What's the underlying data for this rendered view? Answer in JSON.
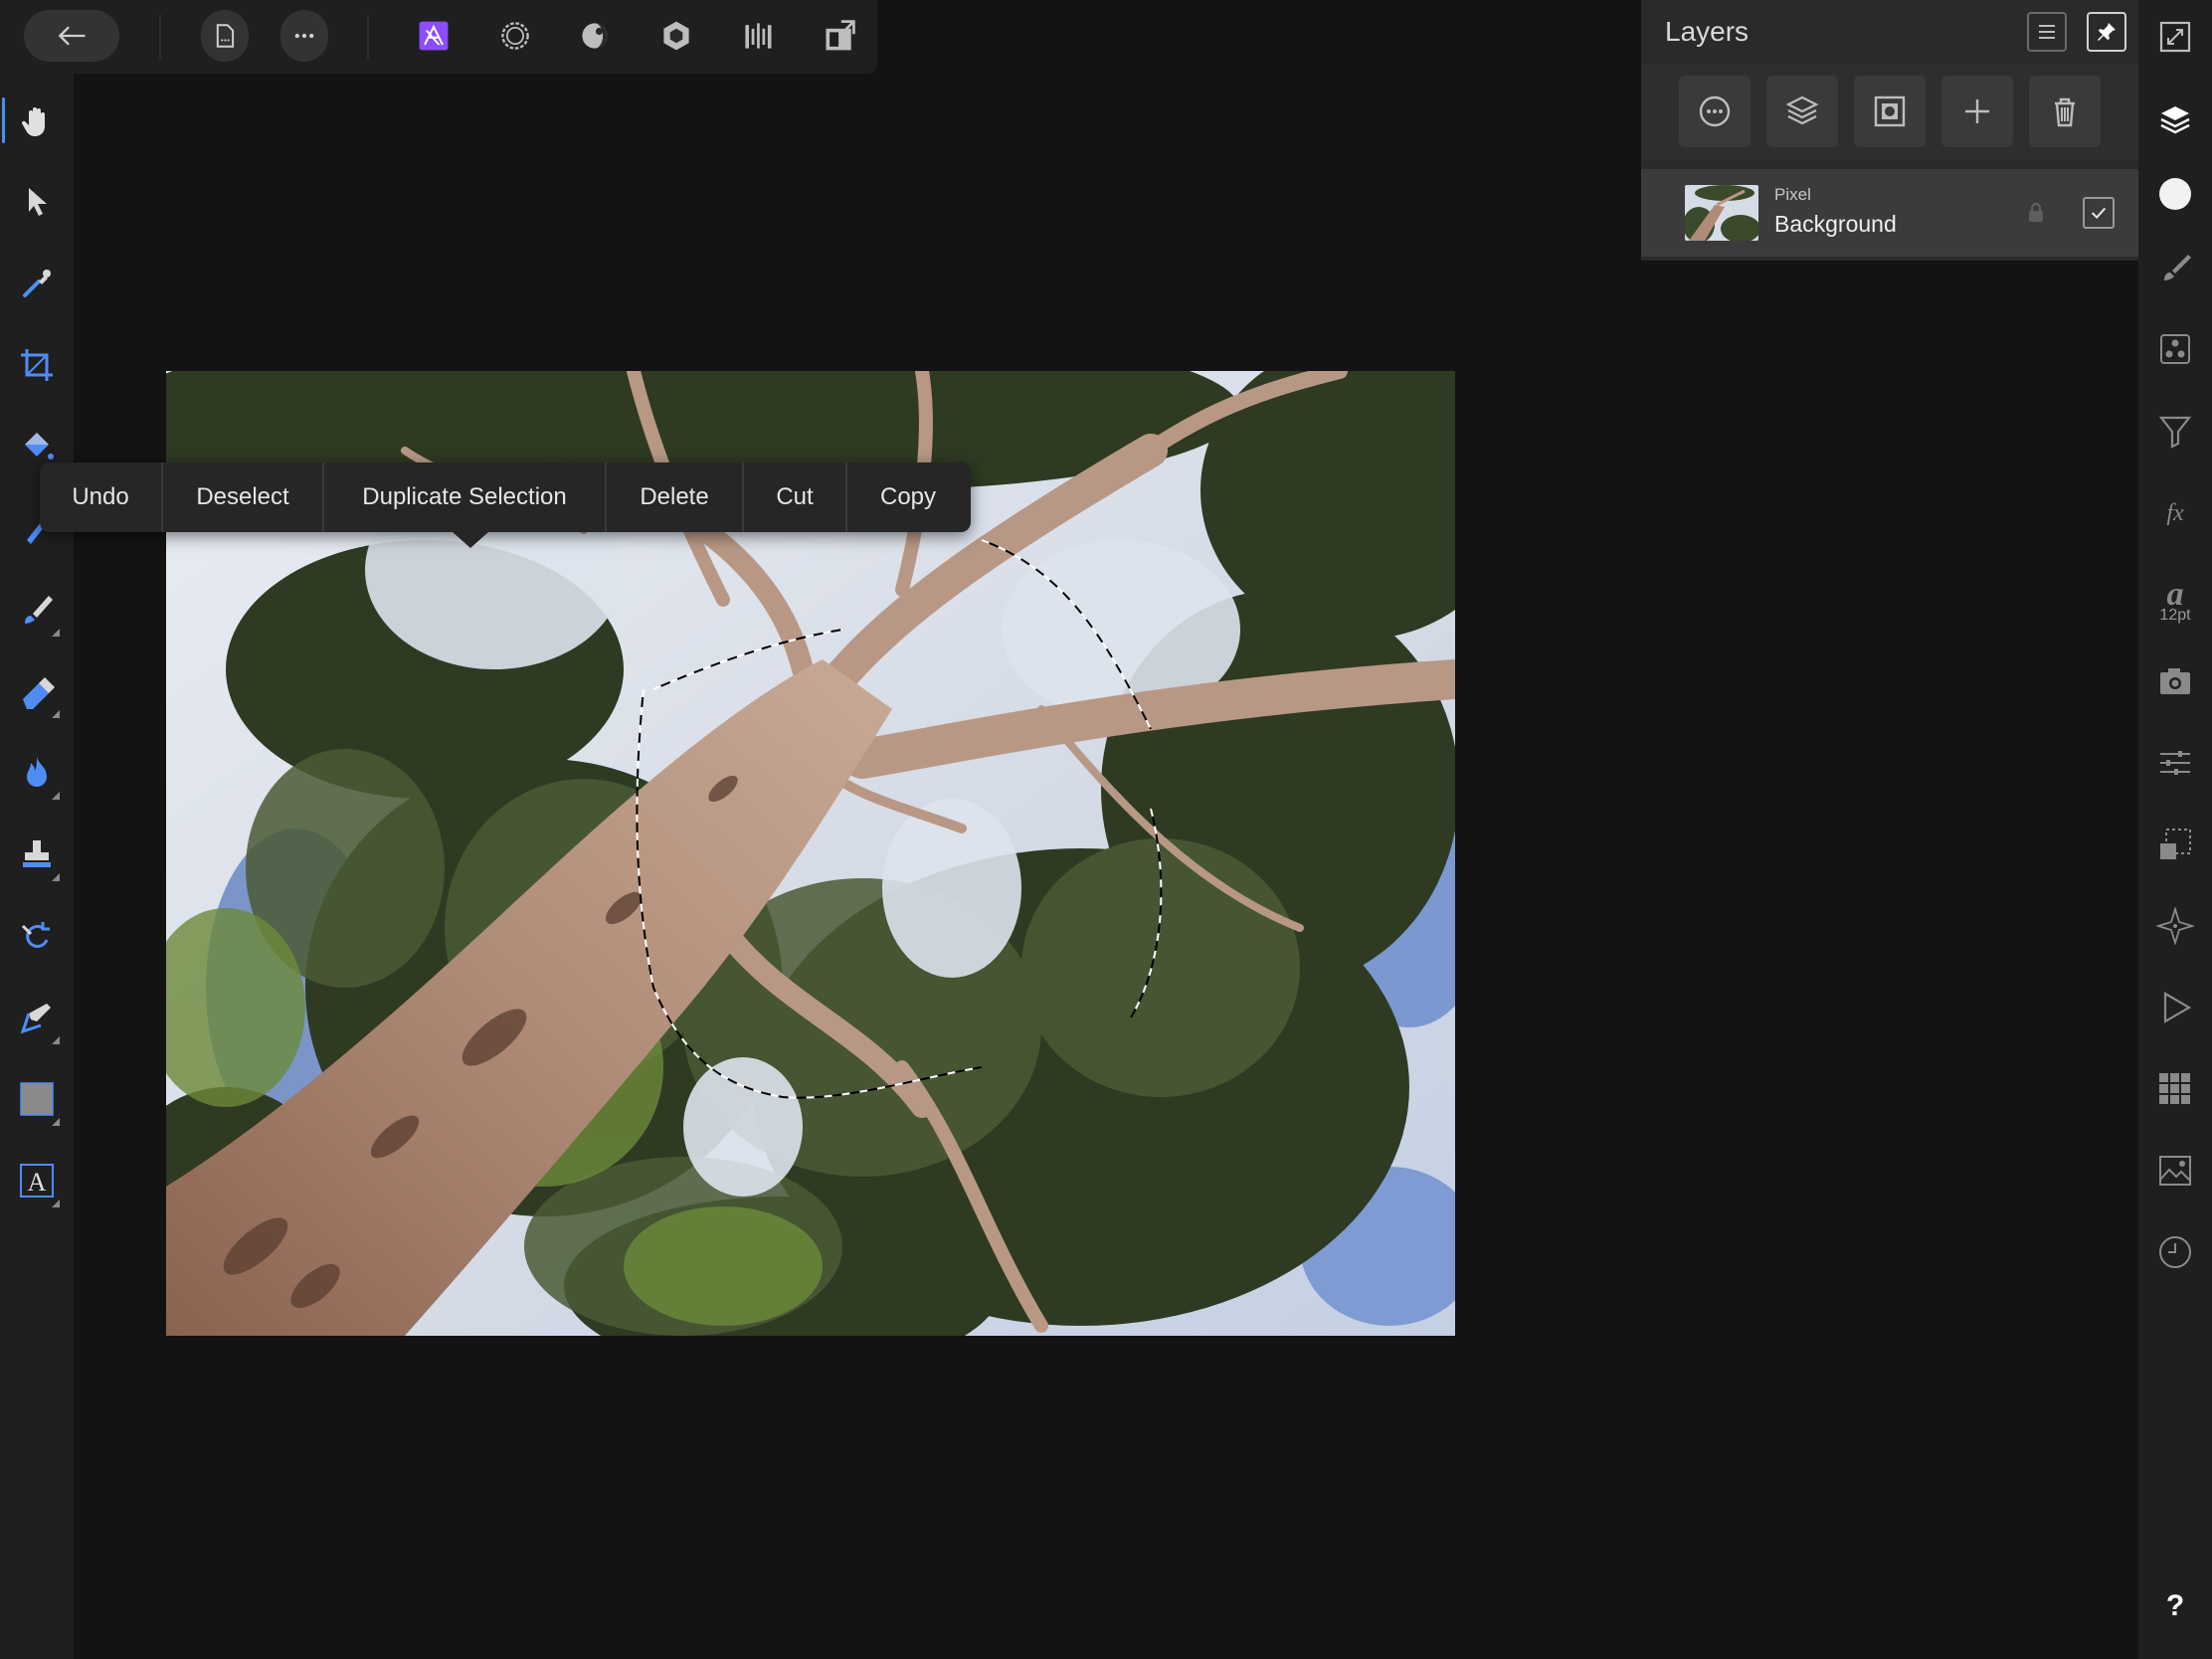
{
  "top_bar": {
    "back_icon": "back-arrow-icon",
    "document_icon": "document-icon",
    "more_icon": "more-icon",
    "personas": [
      "photo-persona-icon",
      "liquify-persona-icon",
      "develop-persona-icon",
      "tone-mapping-persona-icon",
      "export-persona-icon"
    ],
    "view_mode_icon": "view-mode-icon"
  },
  "context_menu": {
    "items": [
      "Undo",
      "Deselect",
      "Duplicate Selection",
      "Delete",
      "Cut",
      "Copy"
    ]
  },
  "layers_panel": {
    "title": "Layers",
    "layer": {
      "type": "Pixel",
      "name": "Background",
      "visible": true,
      "locked": false
    }
  },
  "right_bar": {
    "font_size": "12pt",
    "help": "?"
  },
  "colors": {
    "background": "#131313",
    "panel": "#2a2a2a",
    "accent_persona": "#8b4dff",
    "tool_active": "#4f8df5"
  }
}
